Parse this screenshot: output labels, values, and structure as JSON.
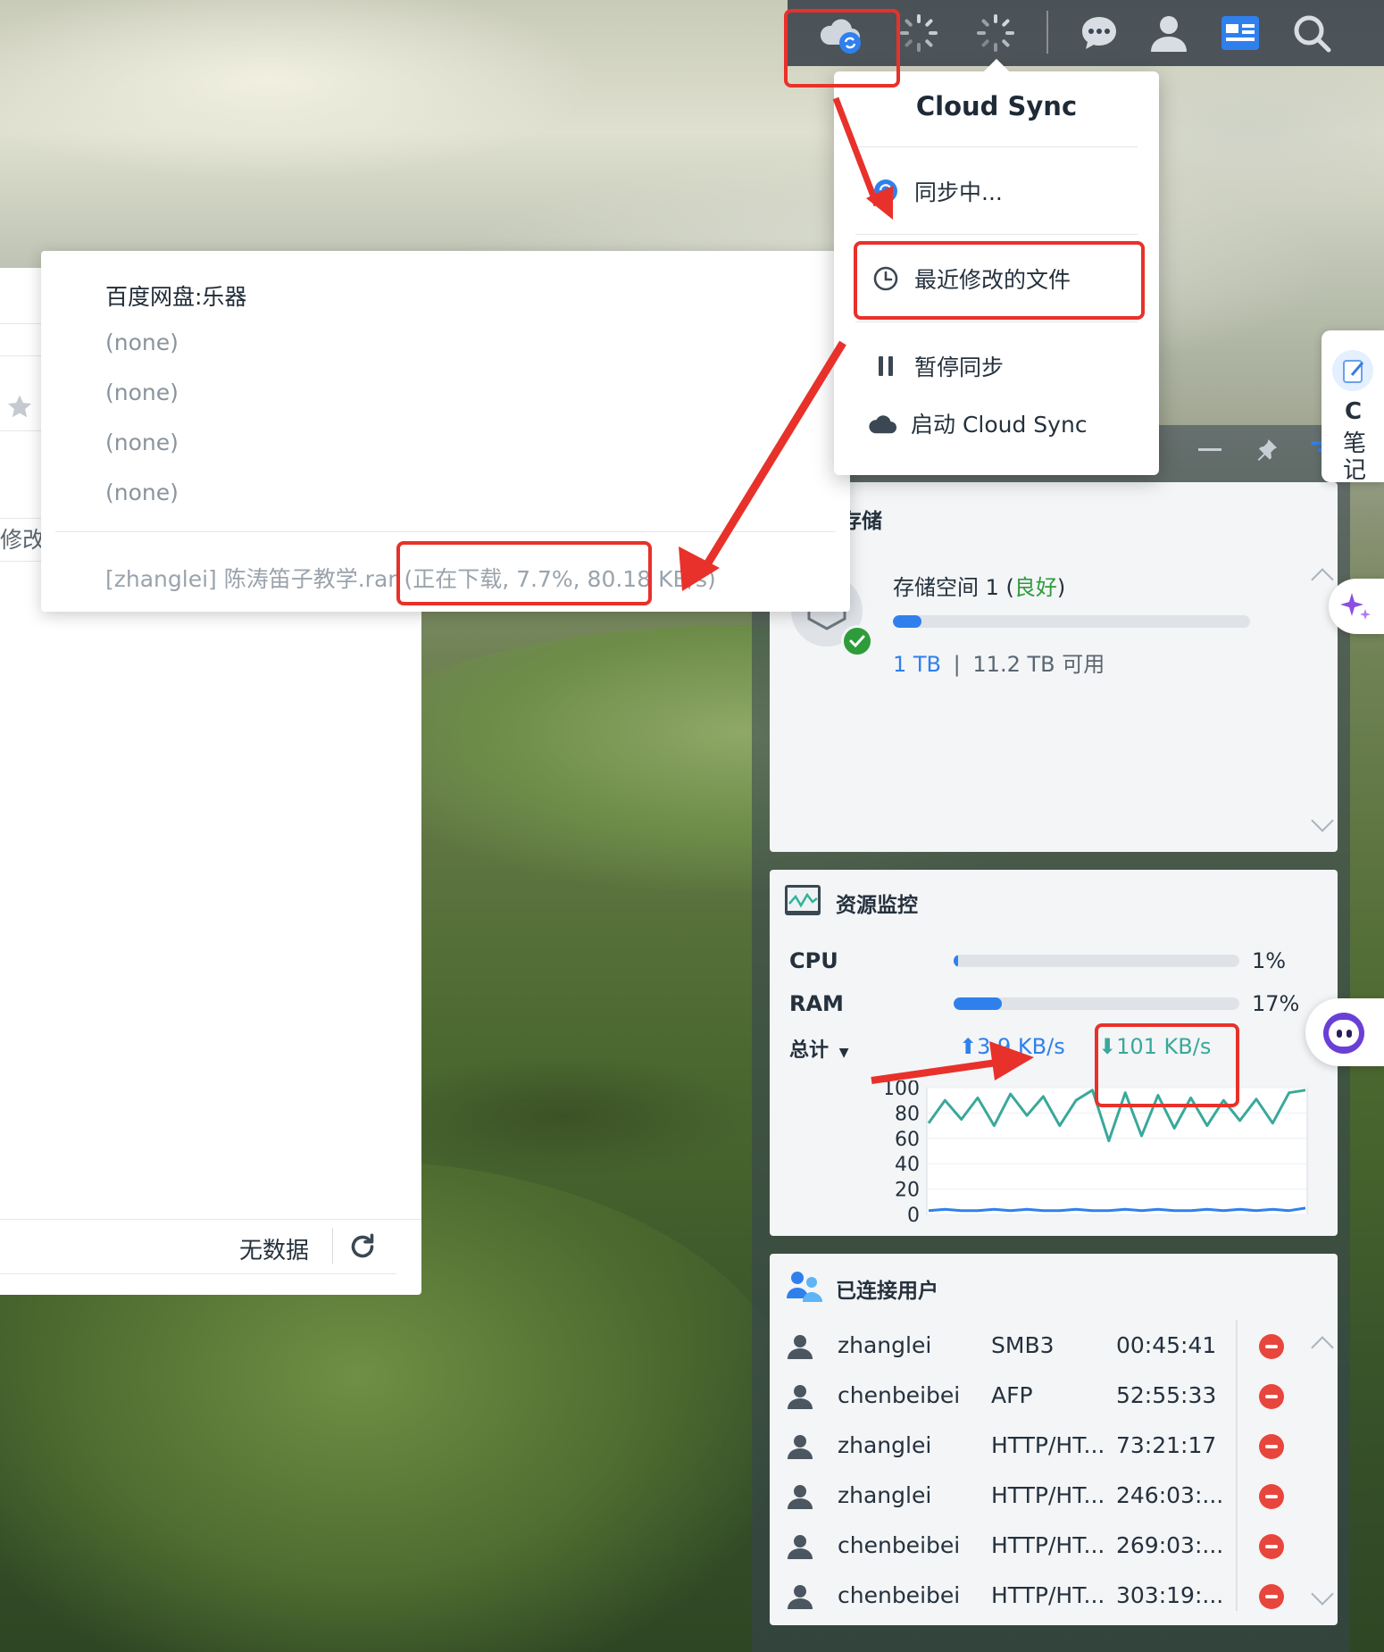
{
  "popover": {
    "title": "Cloud Sync",
    "items": [
      "同步中...",
      "最近修改的文件",
      "暂停同步",
      "启动 Cloud Sync"
    ]
  },
  "recent_files": {
    "header": "百度网盘:乐器",
    "entries": [
      "(none)",
      "(none)",
      "(none)",
      "(none)"
    ],
    "download_line": "[zhanglei] 陈涛笛子教学.rar (正在下载, 7.7%, 80.18 KB/s)"
  },
  "background_window": {
    "partial_label": "修改",
    "no_data": "无数据"
  },
  "storage": {
    "title": "存储",
    "volume_prefix": "存储空间 1 (",
    "status": "良好",
    "volume_suffix": ")",
    "used": "1 TB",
    "separator": "|",
    "available": "11.2 TB 可用",
    "usage_fraction": 0.08
  },
  "resource_monitor": {
    "title": "资源监控",
    "cpu_label": "CPU",
    "cpu_value": "1%",
    "cpu_fraction": 0.01,
    "ram_label": "RAM",
    "ram_value": "17%",
    "ram_fraction": 0.17,
    "total_label": "总计",
    "upload": "3.9 KB/s",
    "download": "101 KB/s"
  },
  "chart_data": {
    "type": "line",
    "ylim": [
      0,
      100
    ],
    "yticks": [
      "100",
      "80",
      "60",
      "40",
      "20",
      "0"
    ],
    "series": [
      {
        "color": "#3aa89b",
        "values": [
          72,
          90,
          75,
          92,
          70,
          95,
          78,
          93,
          70,
          90,
          98,
          58,
          96,
          62,
          94,
          68,
          92,
          70,
          90,
          74,
          91,
          72,
          96,
          98
        ]
      },
      {
        "color": "#2f80ed",
        "values": [
          3,
          4,
          3,
          3,
          4,
          3,
          4,
          3,
          3,
          4,
          3,
          3,
          4,
          3,
          4,
          3,
          3,
          4,
          3,
          4,
          3,
          4,
          3,
          5
        ]
      }
    ]
  },
  "connected_users": {
    "title": "已连接用户",
    "rows": [
      {
        "name": "zhanglei",
        "protocol": "SMB3",
        "time": "00:45:41"
      },
      {
        "name": "chenbeibei",
        "protocol": "AFP",
        "time": "52:55:33"
      },
      {
        "name": "zhanglei",
        "protocol": "HTTP/HT...",
        "time": "73:21:17"
      },
      {
        "name": "zhanglei",
        "protocol": "HTTP/HT...",
        "time": "246:03:..."
      },
      {
        "name": "chenbeibei",
        "protocol": "HTTP/HT...",
        "time": "269:03:..."
      },
      {
        "name": "chenbeibei",
        "protocol": "HTTP/HT...",
        "time": "303:19:..."
      }
    ]
  },
  "side_dock": {
    "letter": "C",
    "label1": "笔",
    "label2": "记"
  },
  "colors": {
    "accent": "#2f80ed",
    "highlight": "#e8312a",
    "good": "#2e9c3a",
    "danger": "#e8453c"
  }
}
